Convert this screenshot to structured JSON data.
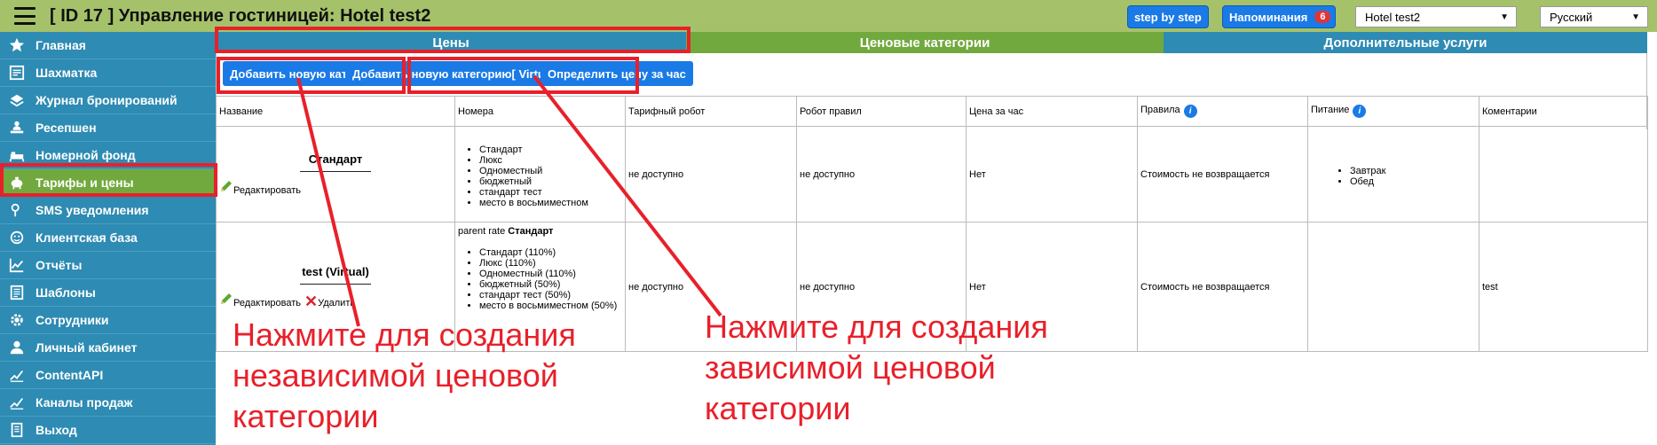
{
  "header": {
    "title": "[ ID 17 ] Управление гостиницей: Hotel test2",
    "step_by_step": "step by step",
    "reminders_label": "Напоминания",
    "reminders_count": "6",
    "hotel_select": "Hotel test2",
    "language_select": "Русский"
  },
  "sidebar": {
    "items": [
      {
        "label": "Главная",
        "icon": "star-icon"
      },
      {
        "label": "Шахматка",
        "icon": "grid-icon"
      },
      {
        "label": "Журнал бронирований",
        "icon": "journal-icon"
      },
      {
        "label": "Ресепшен",
        "icon": "reception-icon"
      },
      {
        "label": "Номерной фонд",
        "icon": "room-icon"
      },
      {
        "label": "Тарифы и цены",
        "icon": "piggy-bank-icon"
      },
      {
        "label": "SMS уведомления",
        "icon": "sms-icon"
      },
      {
        "label": "Клиентская база",
        "icon": "client-icon"
      },
      {
        "label": "Отчёты",
        "icon": "chart-icon"
      },
      {
        "label": "Шаблоны",
        "icon": "template-icon"
      },
      {
        "label": "Сотрудники",
        "icon": "gear-icon"
      },
      {
        "label": "Личный кабинет",
        "icon": "user-icon"
      },
      {
        "label": "ContentAPI",
        "icon": "api-icon"
      },
      {
        "label": "Каналы продаж",
        "icon": "channels-icon"
      },
      {
        "label": "Выход",
        "icon": "exit-icon"
      }
    ],
    "active_index": 5
  },
  "tabs": {
    "prices": "Цены",
    "price_categories": "Ценовые категории",
    "extra_services": "Дополнительные услуги"
  },
  "actions": {
    "add_category": "Добавить новую категорию",
    "add_virtual_category": "Добавить новую категорию[ Virtual ]",
    "set_hourly_price": "Определить цену за час"
  },
  "table": {
    "headers": {
      "name": "Название",
      "rooms": "Номера",
      "tariff_robot": "Тарифный робот",
      "rules_robot": "Робот правил",
      "hourly_price": "Цена за час",
      "rules": "Правила",
      "meals": "Питание",
      "comments": "Коментарии"
    },
    "rows": [
      {
        "name": "Стандарт",
        "edit": "Редактировать",
        "parent_rate_label": "",
        "parent_rate_name": "",
        "rooms": [
          "Стандарт",
          "Люкс",
          "Одноместный",
          "бюджетный",
          "стандарт тест",
          "место в восьмиместном"
        ],
        "tariff_robot": "не доступно",
        "rules_robot": "не доступно",
        "hourly_price": "Нет",
        "rules": "Стоимость не возвращается",
        "meals": [
          "Завтрак",
          "Обед"
        ],
        "comment": ""
      },
      {
        "name": "test (Virtual)",
        "edit": "Редактировать",
        "delete": "Удалить",
        "parent_rate_label": "parent rate",
        "parent_rate_name": "Стандарт",
        "rooms": [
          "Стандарт (110%)",
          "Люкс (110%)",
          "Одноместный (110%)",
          "бюджетный (50%)",
          "стандарт тест (50%)",
          "место в восьмиместном (50%)"
        ],
        "tariff_robot": "не доступно",
        "rules_robot": "не доступно",
        "hourly_price": "Нет",
        "rules": "Стоимость не возвращается",
        "meals": [],
        "comment": "test"
      }
    ]
  },
  "annotations": {
    "independent": [
      "Нажмите для создания",
      "независимой ценовой",
      "категории"
    ],
    "dependent": [
      "Нажмите для создания",
      "зависимой ценовой",
      "категории"
    ],
    "color": "#e8202a"
  },
  "colors": {
    "header_bg": "#a5c26a",
    "sidebar_bg": "#2e8bb3",
    "active_green": "#72a93e",
    "button_blue": "#1a7ae6",
    "annotation_red": "#e8202a"
  }
}
